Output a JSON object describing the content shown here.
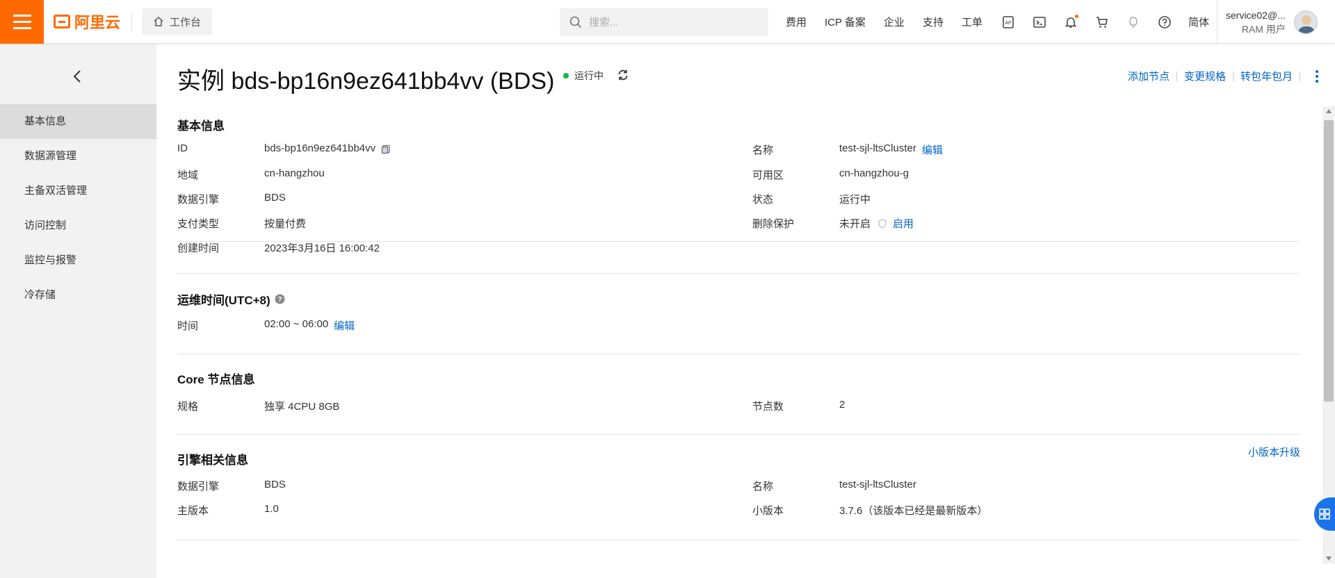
{
  "topbar": {
    "logo_text": "阿里云",
    "workbench_label": "工作台",
    "search_placeholder": "搜索...",
    "nav_links": [
      "费用",
      "ICP 备案",
      "企业",
      "支持",
      "工单"
    ],
    "lang_label": "简体",
    "user_name": "service02@...",
    "user_role": "RAM 用户",
    "accent_color": "#ff6a00"
  },
  "sidebar": {
    "items": [
      {
        "label": "基本信息",
        "active": true
      },
      {
        "label": "数据源管理"
      },
      {
        "label": "主备双活管理"
      },
      {
        "label": "访问控制"
      },
      {
        "label": "监控与报警"
      },
      {
        "label": "冷存储"
      }
    ]
  },
  "header": {
    "title": "实例 bds-bp16n9ez641bb4vv (BDS)",
    "status": "运行中",
    "status_color": "#1ab34c",
    "actions": [
      "添加节点",
      "变更规格",
      "转包年包月"
    ],
    "link_color": "#0064c8"
  },
  "basic_info": {
    "title": "基本信息",
    "left": [
      {
        "label": "ID",
        "value": "bds-bp16n9ez641bb4vv"
      },
      {
        "label": "地域",
        "value": "cn-hangzhou"
      },
      {
        "label": "数据引擎",
        "value": "BDS"
      },
      {
        "label": "支付类型",
        "value": "按量付费"
      },
      {
        "label": "创建时间",
        "value": "2023年3月16日 16:00:42"
      }
    ],
    "right": [
      {
        "label": "名称",
        "value": "test-sjl-ltsCluster",
        "link": "编辑"
      },
      {
        "label": "可用区",
        "value": "cn-hangzhou-g"
      },
      {
        "label": "状态",
        "value": "运行中"
      },
      {
        "label": "删除保护",
        "value": "未开启",
        "link": "启用"
      }
    ]
  },
  "maintenance": {
    "title": "运维时间(UTC+8)",
    "label": "时间",
    "value": "02:00 ~ 06:00",
    "link": "编辑"
  },
  "core_node": {
    "title": "Core 节点信息",
    "spec_label": "规格",
    "spec_value": "独享 4CPU 8GB",
    "count_label": "节点数",
    "count_value": "2"
  },
  "engine": {
    "title": "引擎相关信息",
    "upgrade_link": "小版本升级",
    "engine_label": "数据引擎",
    "engine_value": "BDS",
    "name_label": "名称",
    "name_value": "test-sjl-ltsCluster",
    "major_label": "主版本",
    "major_value": "1.0",
    "minor_label": "小版本",
    "minor_value": "3.7.6（该版本已经是最新版本）"
  }
}
